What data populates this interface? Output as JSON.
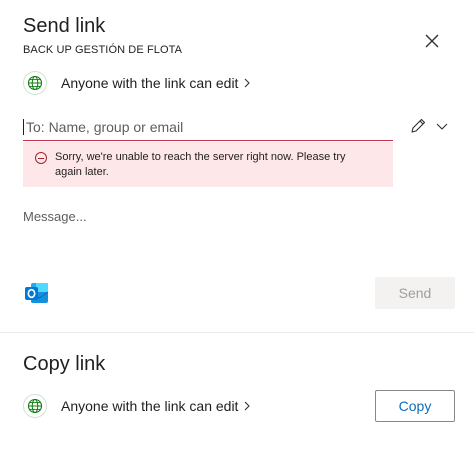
{
  "send_link": {
    "title": "Send link",
    "item_name": "BACK UP GESTIÓN DE FLOTA",
    "permission_label": "Anyone with the link can edit",
    "to_placeholder": "To: Name, group or email",
    "error_message": "Sorry, we're unable to reach the server right now. Please try again later.",
    "message_placeholder": "Message...",
    "send_label": "Send"
  },
  "copy_link": {
    "title": "Copy link",
    "permission_label": "Anyone with the link can edit",
    "copy_label": "Copy"
  },
  "icons": {
    "close": "close-icon",
    "globe": "globe-icon",
    "chevron_right": "chevron-right-icon",
    "pencil": "pencil-icon",
    "chevron_down": "chevron-down-icon",
    "error": "error-circle-icon",
    "outlook": "outlook-icon"
  },
  "colors": {
    "error_background": "#fde7e9",
    "error_accent": "#a4262c",
    "link_blue": "#0f6cbd",
    "globe_green": "#107c10",
    "outlook_blue": "#0078d4"
  }
}
